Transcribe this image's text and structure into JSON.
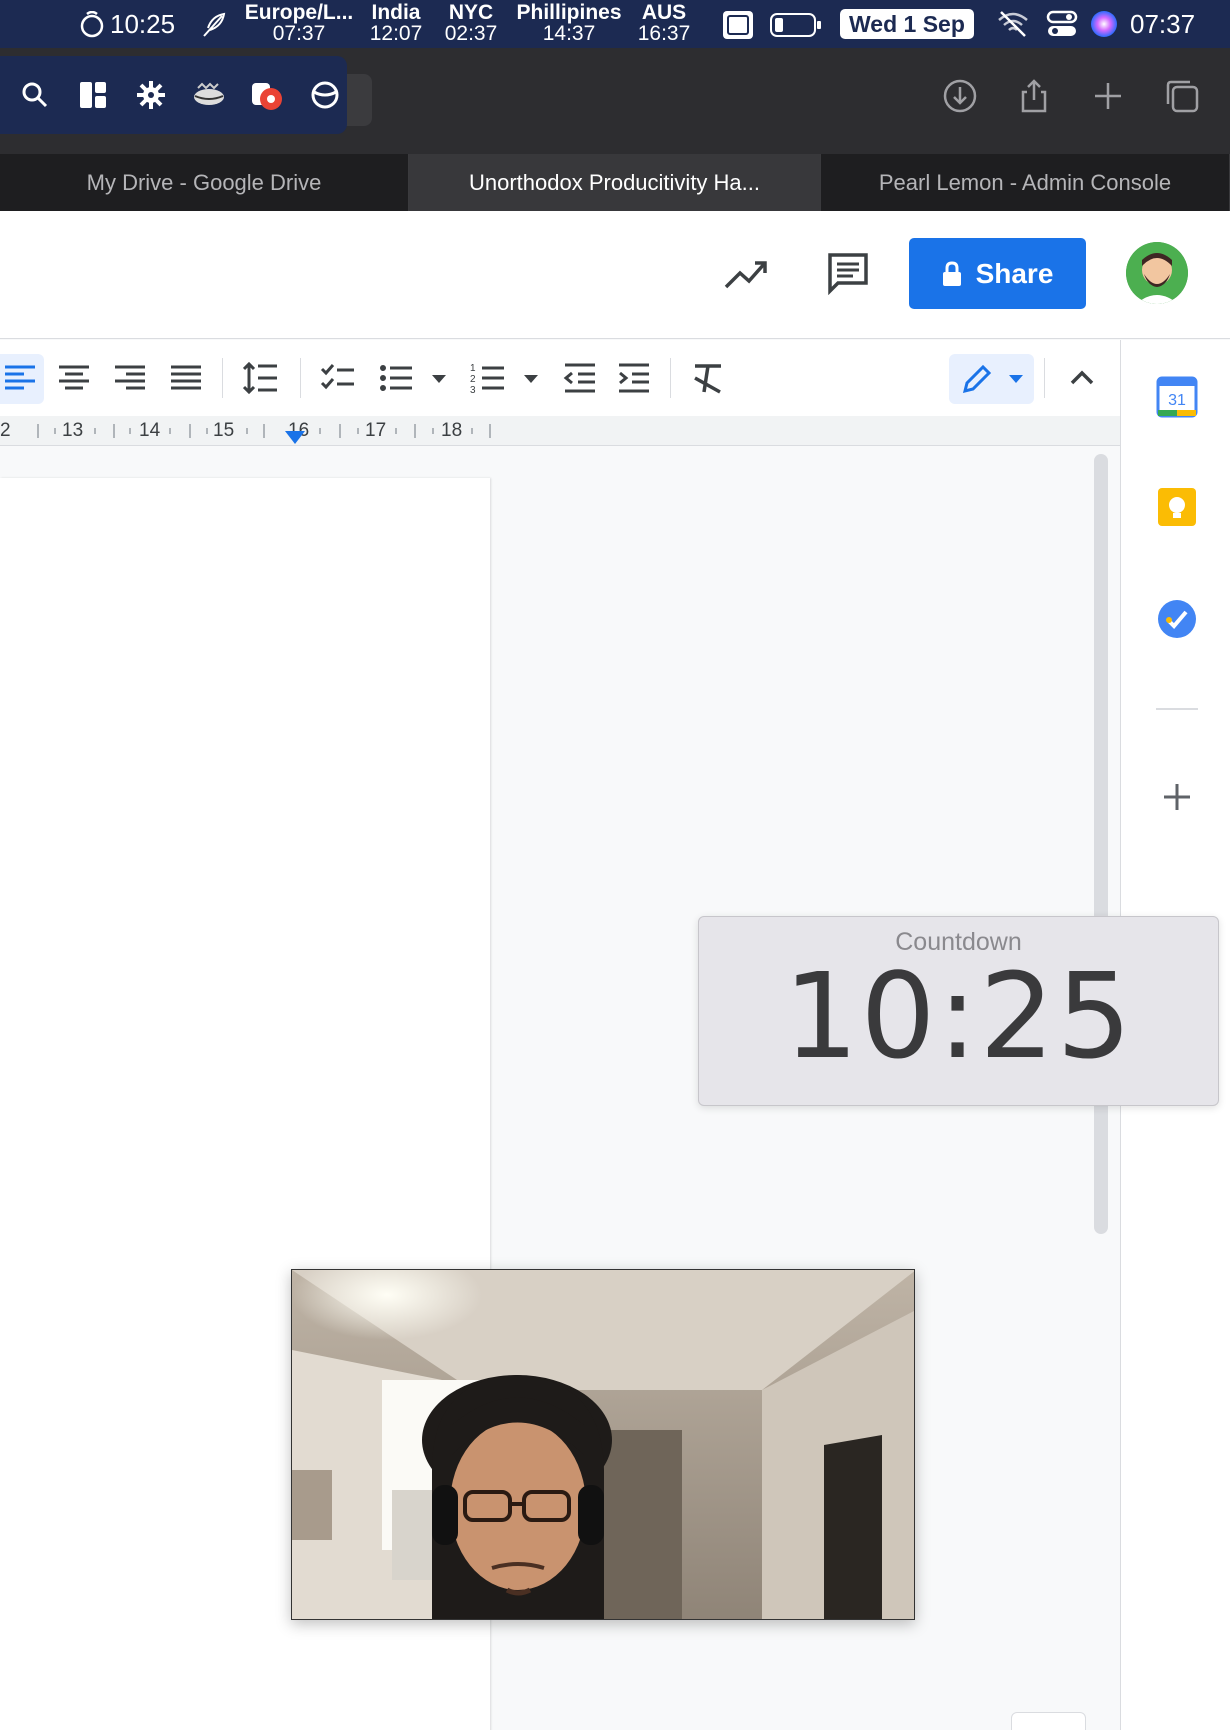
{
  "menubar": {
    "timer": "10:25",
    "timezones": [
      {
        "name": "Europe/L...",
        "time": "07:37"
      },
      {
        "name": "India",
        "time": "12:07"
      },
      {
        "name": "NYC",
        "time": "02:37"
      },
      {
        "name": "Phillipines",
        "time": "14:37"
      },
      {
        "name": "AUS",
        "time": "16:37"
      }
    ],
    "date": "Wed 1 Sep",
    "clock": "07:37"
  },
  "tabs": [
    {
      "label": "My Drive - Google Drive",
      "active": false
    },
    {
      "label": "Unorthodox Producitivity Ha...",
      "active": true
    },
    {
      "label": "Pearl Lemon - Admin Console",
      "active": false
    }
  ],
  "docs": {
    "share_label": "Share"
  },
  "ruler": {
    "marks": [
      "2",
      "13",
      "14",
      "15",
      "16",
      "17",
      "18"
    ]
  },
  "side_panel": {
    "calendar_day": "31"
  },
  "countdown": {
    "label": "Countdown",
    "time": "10:25"
  },
  "colors": {
    "menubar": "#1c2a52",
    "share": "#1a73e8",
    "accent_blue": "#1a73e8"
  }
}
